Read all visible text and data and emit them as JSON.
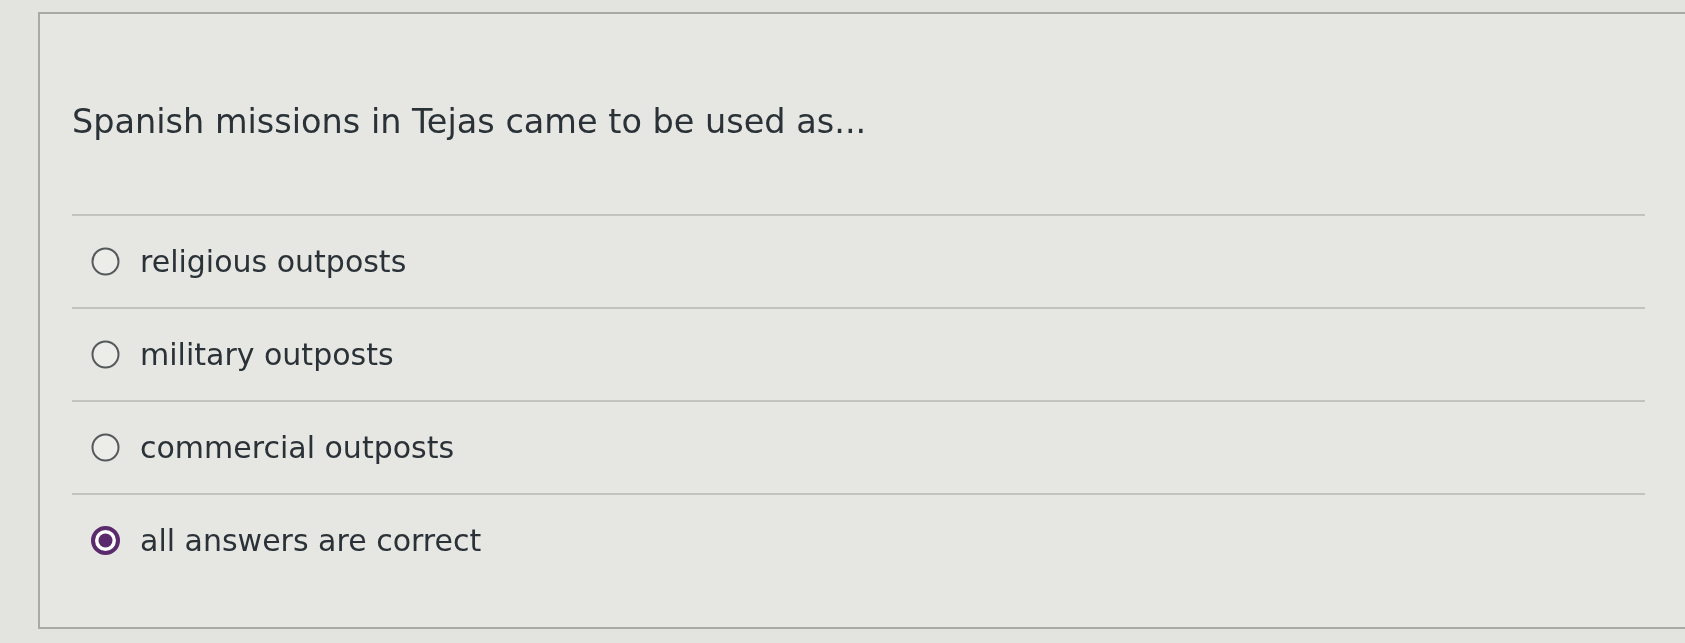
{
  "question": {
    "text": "Spanish missions in Tejas came to be used as..."
  },
  "answers": [
    {
      "label": "religious outposts",
      "selected": false
    },
    {
      "label": "military outposts",
      "selected": false
    },
    {
      "label": "commercial outposts",
      "selected": false
    },
    {
      "label": "all answers are correct",
      "selected": true
    }
  ]
}
